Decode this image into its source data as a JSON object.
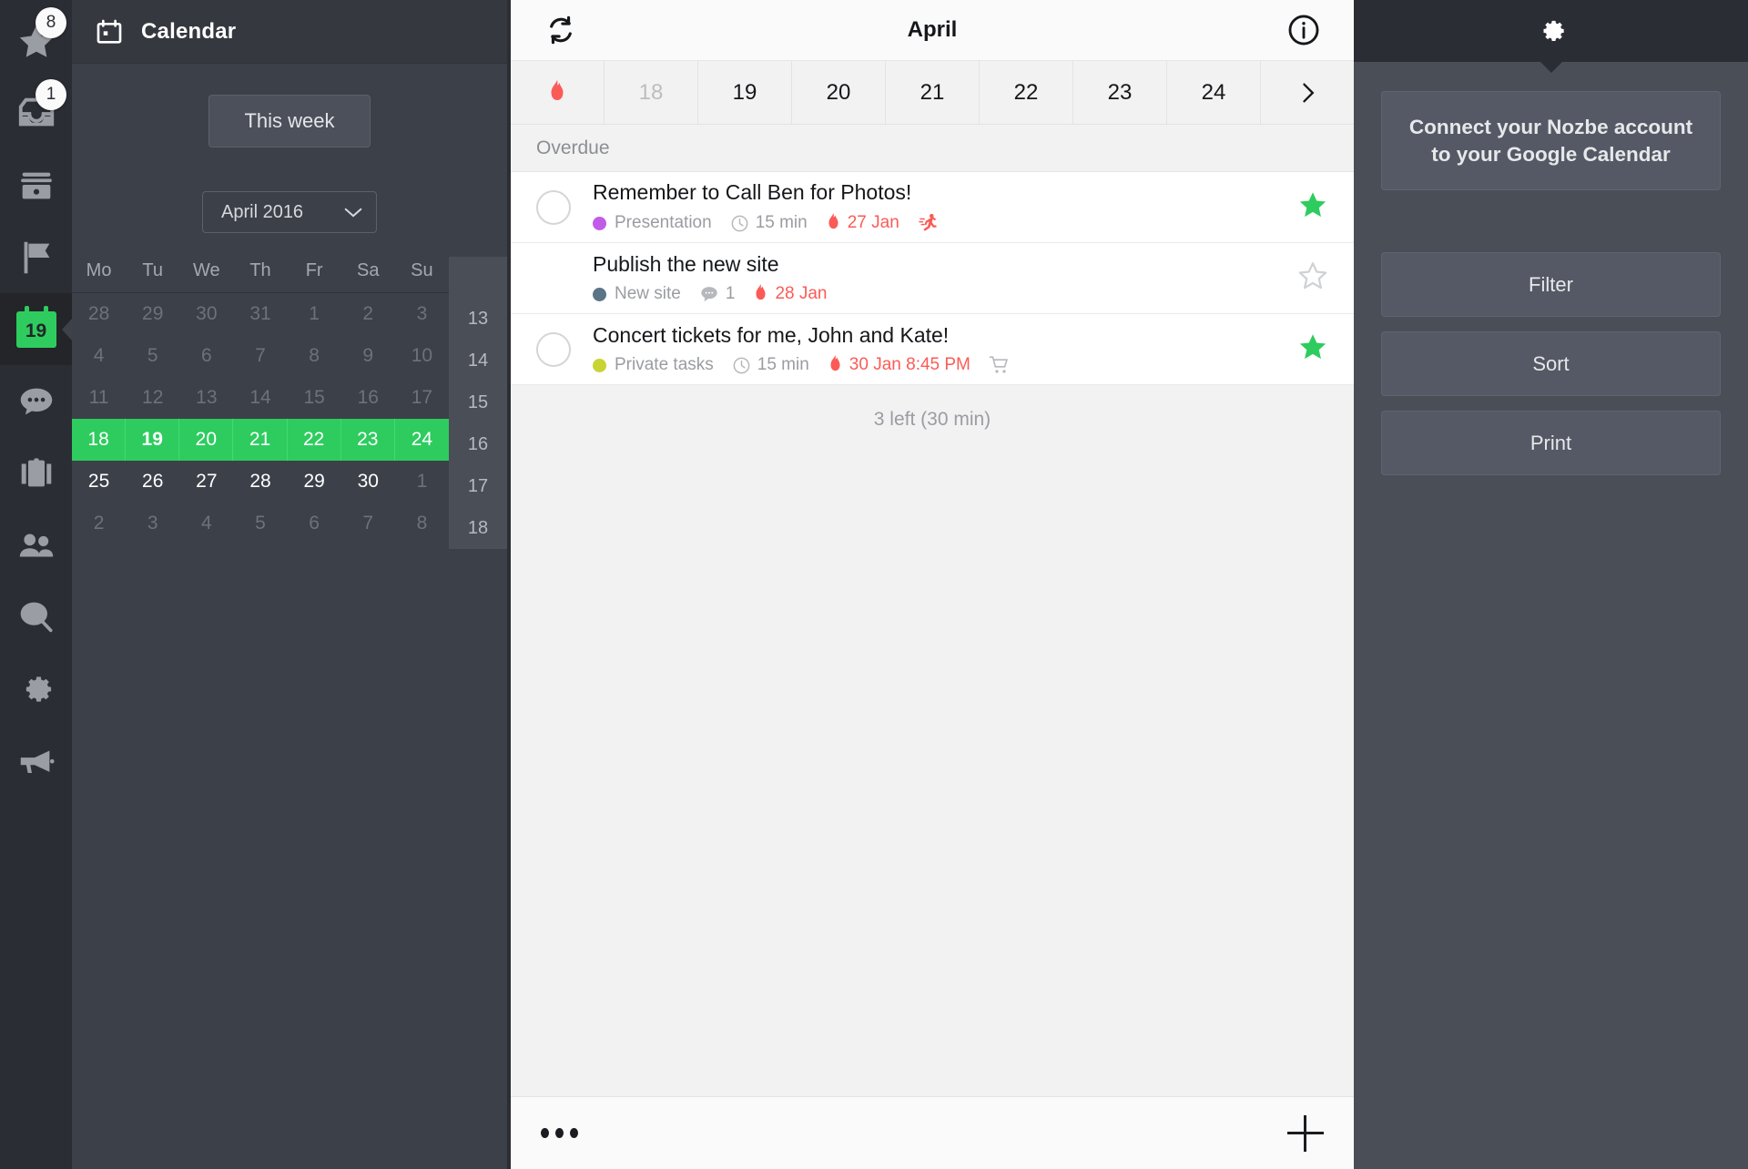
{
  "rail": {
    "items": [
      {
        "name": "priority",
        "icon": "star-icon",
        "badge": "8"
      },
      {
        "name": "inbox",
        "icon": "inbox-icon",
        "badge": "1"
      },
      {
        "name": "archive",
        "icon": "archive-icon",
        "badge": null
      },
      {
        "name": "next",
        "icon": "flag-icon",
        "badge": null
      },
      {
        "name": "calendar",
        "icon": "calendar-icon",
        "badge": null,
        "day": "19",
        "active": true
      },
      {
        "name": "comments",
        "icon": "comment-icon",
        "badge": null
      },
      {
        "name": "projects",
        "icon": "briefcase-icon",
        "badge": null
      },
      {
        "name": "team",
        "icon": "people-icon",
        "badge": null
      },
      {
        "name": "search",
        "icon": "search-icon",
        "badge": null
      },
      {
        "name": "settings",
        "icon": "gear-icon",
        "badge": null
      },
      {
        "name": "news",
        "icon": "megaphone-icon",
        "badge": null
      }
    ]
  },
  "calendar": {
    "header_title": "Calendar",
    "this_week_label": "This week",
    "month_selector_value": "April 2016",
    "weekday_headers": [
      "Mo",
      "Tu",
      "We",
      "Th",
      "Fr",
      "Sa",
      "Su"
    ],
    "week_numbers": [
      "13",
      "14",
      "15",
      "16",
      "17",
      "18"
    ],
    "weeks": [
      {
        "selected": false,
        "days": [
          {
            "n": "28",
            "dim": true
          },
          {
            "n": "29",
            "dim": true
          },
          {
            "n": "30",
            "dim": true
          },
          {
            "n": "31",
            "dim": true
          },
          {
            "n": "1",
            "dim": true
          },
          {
            "n": "2",
            "dim": true
          },
          {
            "n": "3",
            "dim": true
          }
        ]
      },
      {
        "selected": false,
        "days": [
          {
            "n": "4",
            "dim": true
          },
          {
            "n": "5",
            "dim": true
          },
          {
            "n": "6",
            "dim": true
          },
          {
            "n": "7",
            "dim": true
          },
          {
            "n": "8",
            "dim": true
          },
          {
            "n": "9",
            "dim": true
          },
          {
            "n": "10",
            "dim": true
          }
        ]
      },
      {
        "selected": false,
        "days": [
          {
            "n": "11",
            "dim": true
          },
          {
            "n": "12",
            "dim": true
          },
          {
            "n": "13",
            "dim": true
          },
          {
            "n": "14",
            "dim": true
          },
          {
            "n": "15",
            "dim": true
          },
          {
            "n": "16",
            "dim": true
          },
          {
            "n": "17",
            "dim": true
          }
        ]
      },
      {
        "selected": true,
        "days": [
          {
            "n": "18",
            "dim": false
          },
          {
            "n": "19",
            "dim": false,
            "today": true
          },
          {
            "n": "20",
            "dim": false
          },
          {
            "n": "21",
            "dim": false
          },
          {
            "n": "22",
            "dim": false
          },
          {
            "n": "23",
            "dim": false
          },
          {
            "n": "24",
            "dim": false
          }
        ]
      },
      {
        "selected": false,
        "days": [
          {
            "n": "25",
            "dim": false
          },
          {
            "n": "26",
            "dim": false
          },
          {
            "n": "27",
            "dim": false
          },
          {
            "n": "28",
            "dim": false
          },
          {
            "n": "29",
            "dim": false
          },
          {
            "n": "30",
            "dim": false
          },
          {
            "n": "1",
            "dim": true
          }
        ]
      },
      {
        "selected": false,
        "days": [
          {
            "n": "2",
            "dim": true
          },
          {
            "n": "3",
            "dim": true
          },
          {
            "n": "4",
            "dim": true
          },
          {
            "n": "5",
            "dim": true
          },
          {
            "n": "6",
            "dim": true
          },
          {
            "n": "7",
            "dim": true
          },
          {
            "n": "8",
            "dim": true
          }
        ]
      }
    ],
    "selected_color": "#2ecc5f"
  },
  "center": {
    "sync_icon": "refresh-icon",
    "title": "April",
    "info_icon": "info-icon",
    "date_tabs": [
      {
        "label": "",
        "icon": "flame-icon",
        "dim": false
      },
      {
        "label": "18",
        "dim": true
      },
      {
        "label": "19",
        "dim": false
      },
      {
        "label": "20",
        "dim": false
      },
      {
        "label": "21",
        "dim": false
      },
      {
        "label": "22",
        "dim": false
      },
      {
        "label": "23",
        "dim": false
      },
      {
        "label": "24",
        "dim": false
      },
      {
        "label": "",
        "icon": "chevron-right-icon",
        "dim": false
      }
    ],
    "section_label": "Overdue",
    "tasks": [
      {
        "name": "Remember to Call Ben for Photos!",
        "checkbox": true,
        "project": "Presentation",
        "project_color": "#c05ce8",
        "time": "15 min",
        "due": "27 Jan",
        "starred": true,
        "extra_icon": "running-icon",
        "comments": null
      },
      {
        "name": "Publish the new site",
        "checkbox": false,
        "project": "New site",
        "project_color": "#5b7486",
        "time": null,
        "due": "28 Jan",
        "starred": false,
        "extra_icon": null,
        "comments": "1"
      },
      {
        "name": "Concert tickets for me, John and Kate!",
        "checkbox": true,
        "project": "Private tasks",
        "project_color": "#c8d433",
        "time": "15 min",
        "due": "30 Jan 8:45 PM",
        "starred": true,
        "extra_icon": "cart-icon",
        "comments": null
      }
    ],
    "summary": "3 left (30 min)",
    "footer": {
      "more_label": "...",
      "add_label": "+"
    },
    "accent_red": "#fb5b56",
    "accent_green": "#2ecc5f"
  },
  "right": {
    "gear_icon": "gear-icon",
    "promo_label": "Connect your Nozbe account to your Google Calendar",
    "buttons": [
      {
        "label": "Filter",
        "name": "filter-button"
      },
      {
        "label": "Sort",
        "name": "sort-button"
      },
      {
        "label": "Print",
        "name": "print-button"
      }
    ]
  }
}
